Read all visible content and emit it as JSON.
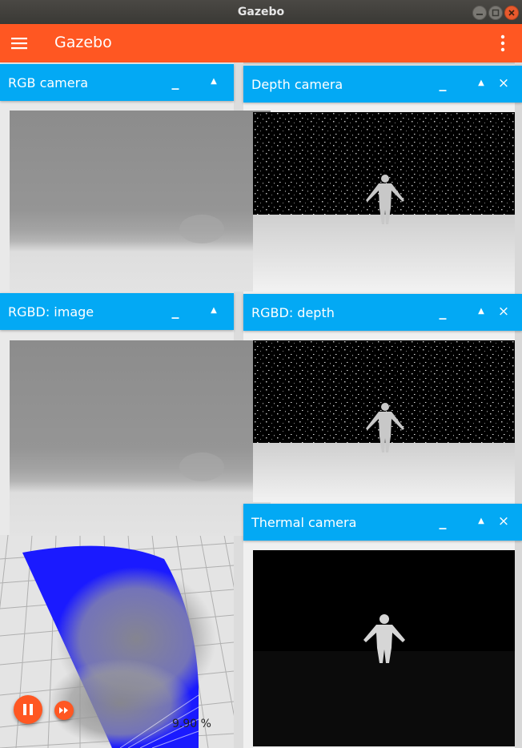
{
  "window": {
    "title": "Gazebo"
  },
  "toolbar": {
    "title": "Gazebo"
  },
  "panels": {
    "rgb_camera": {
      "title": "RGB camera"
    },
    "depth_camera": {
      "title": "Depth camera"
    },
    "rgbd_image": {
      "title": "RGBD: image"
    },
    "rgbd_depth": {
      "title": "RGBD: depth"
    },
    "thermal_camera": {
      "title": "Thermal camera"
    }
  },
  "header_buttons": {
    "minimize": "_",
    "dock": "▲",
    "close": "×"
  },
  "controls": {
    "rtf": "9.90 %"
  },
  "colors": {
    "toolbar": "#ff5722",
    "panel_header": "#03a9f4",
    "lidar": "#1a1aff",
    "titlebar": "#3c3b37"
  },
  "icons": [
    "menu-icon",
    "more-vert-icon",
    "pause-icon",
    "fast-forward-icon",
    "minimize-icon",
    "dock-icon",
    "close-icon"
  ]
}
